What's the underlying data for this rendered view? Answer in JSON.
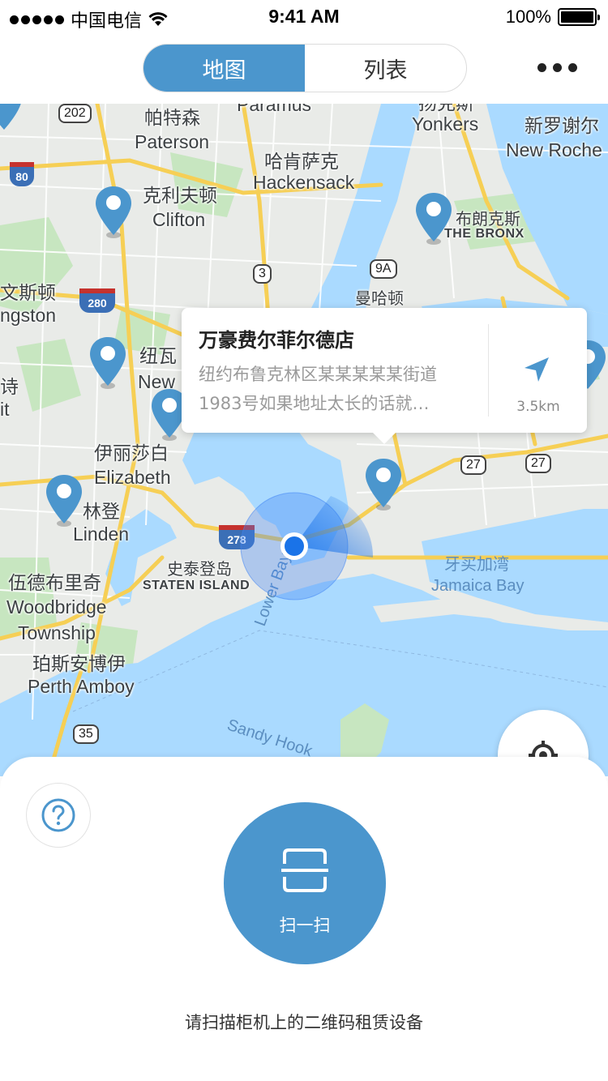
{
  "status_bar": {
    "carrier": "中国电信",
    "time": "9:41 AM",
    "battery_text": "100%"
  },
  "nav": {
    "tabs": [
      {
        "label": "地图",
        "active": true
      },
      {
        "label": "列表",
        "active": false
      }
    ]
  },
  "map": {
    "labels": {
      "paramus": "Paramus",
      "yonkers_cn": "扬克斯",
      "yonkers": "Yonkers",
      "paterson_cn": "帕特森",
      "paterson": "Paterson",
      "newrochelle_cn": "新罗谢尔",
      "newrochelle": "New Roche",
      "hackensack_cn": "哈肯萨克",
      "hackensack": "Hackensack",
      "clifton_cn": "克利夫顿",
      "clifton": "Clifton",
      "bronx_cn": "布朗克斯",
      "bronx": "THE BRONX",
      "livingston_cn": "文斯顿",
      "livingston": "ngston",
      "manhattan_cn": "曼哈顿",
      "newark_cn": "纽瓦",
      "newark": "New",
      "left_cn": "诗",
      "left": "it",
      "elizabeth_cn": "伊丽莎白",
      "elizabeth": "Elizabeth",
      "linden_cn": "林登",
      "linden": "Linden",
      "staten_cn": "史泰登岛",
      "staten": "STATEN ISLAND",
      "woodbridge_cn": "伍德布里奇",
      "woodbridge": "Woodbridge",
      "township": "Township",
      "perth_cn": "珀斯安博伊",
      "perth": "Perth Amboy",
      "jamaica_cn": "牙买加湾",
      "jamaica": "Jamaica Bay",
      "lowerbay": "Lower Bay",
      "sandyhook": "Sandy Hook"
    },
    "routes": {
      "r202": "202",
      "r3": "3",
      "r9a": "9A",
      "r27a": "27",
      "r27b": "27",
      "r35": "35",
      "i80": "80",
      "i280": "280",
      "i278": "278"
    }
  },
  "store_card": {
    "name": "万豪费尔菲尔德店",
    "address_line1": "纽约布鲁克林区某某某某某街道",
    "address_line2": "1983号如果地址太长的话就…",
    "distance": "3.5km"
  },
  "bottom": {
    "scan_label": "扫一扫",
    "hint": "请扫描柜机上的二维码租赁设备"
  },
  "colors": {
    "primary": "#4b96cd",
    "water": "#aadaff",
    "land": "#e8ebe8",
    "park": "#c6e8c0",
    "highway": "#f7d86a",
    "location_dot": "#1a73e8"
  }
}
